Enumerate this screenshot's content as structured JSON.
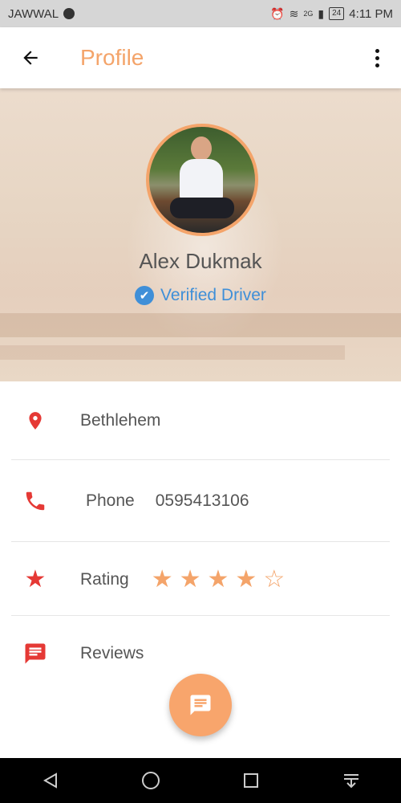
{
  "status_bar": {
    "carrier": "JAWWAL",
    "network": "2G",
    "battery": "24",
    "time": "4:11 PM"
  },
  "app_bar": {
    "title": "Profile",
    "back_icon": "arrow-left-icon",
    "menu_icon": "more-vert-icon"
  },
  "profile": {
    "name": "Alex Dukmak",
    "verified_label": "Verified Driver"
  },
  "details": {
    "location": "Bethlehem",
    "phone_label": "Phone",
    "phone_value": "0595413106",
    "rating_label": "Rating",
    "rating_value": 4,
    "rating_max": 5,
    "reviews_label": "Reviews"
  },
  "colors": {
    "accent": "#f4a46a",
    "icon_red": "#e53935",
    "verified_blue": "#3f8fd8"
  }
}
